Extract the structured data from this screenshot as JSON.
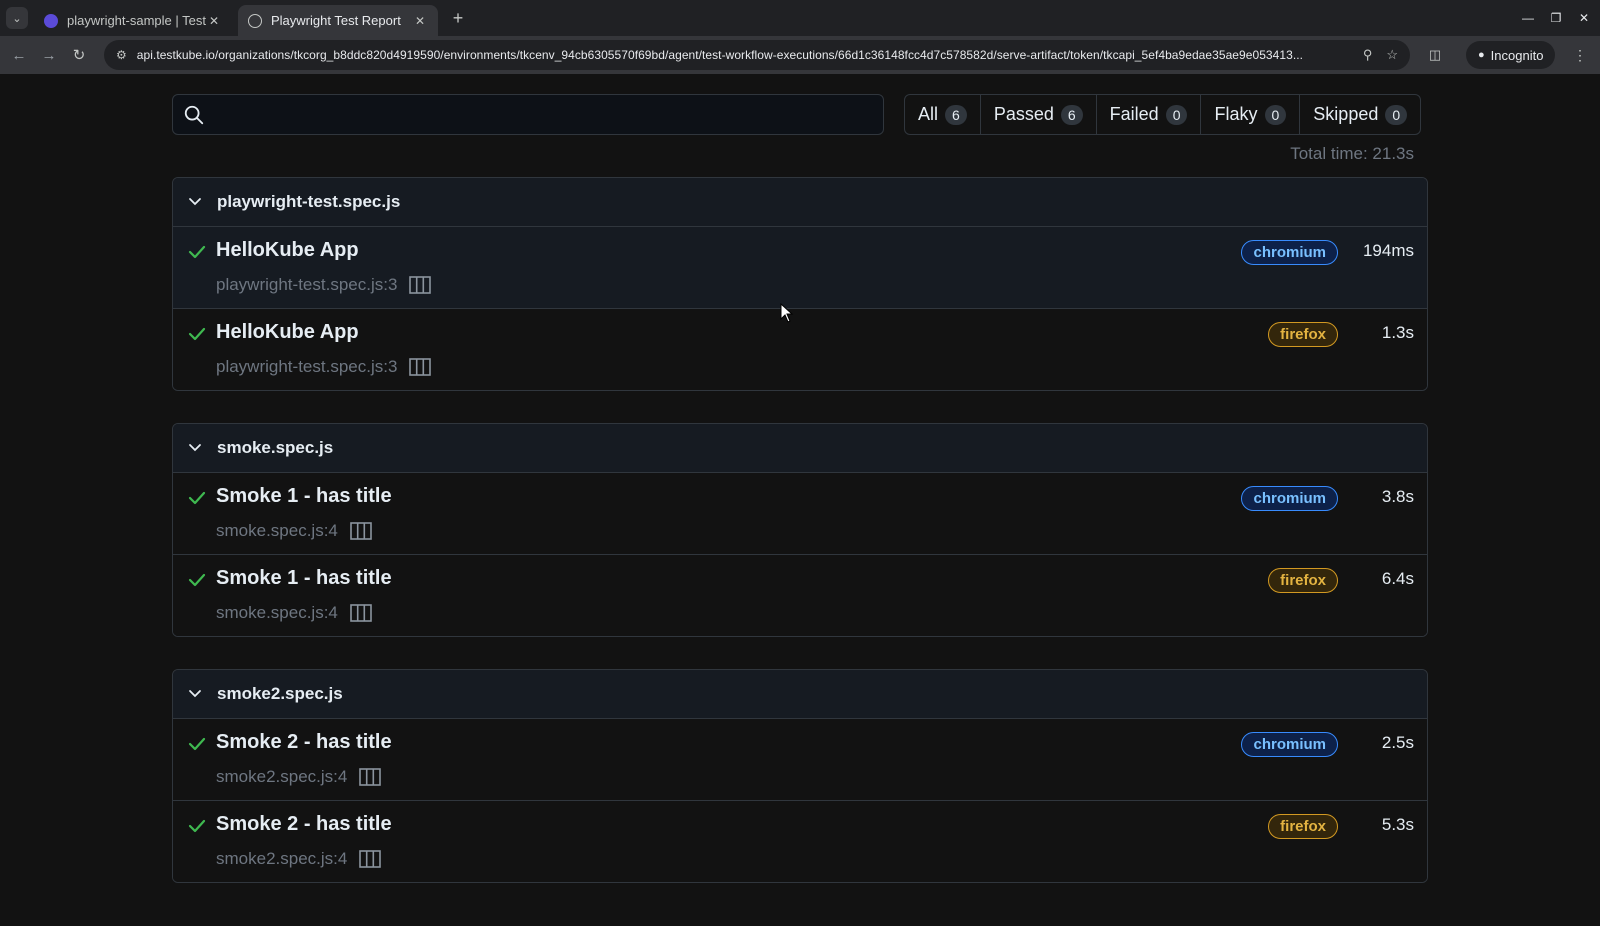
{
  "browser": {
    "tabs": [
      {
        "title": "playwright-sample | Testkube",
        "active": false
      },
      {
        "title": "Playwright Test Report",
        "active": true
      }
    ],
    "url": "api.testkube.io/organizations/tkcorg_b8ddc820d4919590/environments/tkcenv_94cb6305570f69bd/agent/test-workflow-executions/66d1c36148fcc4d7c578582d/serve-artifact/token/tkcapi_5ef4ba9edae35ae9e053413...",
    "incognito_label": "Incognito"
  },
  "search": {
    "value": "",
    "placeholder": ""
  },
  "filters": [
    {
      "label": "All",
      "count": "6"
    },
    {
      "label": "Passed",
      "count": "6"
    },
    {
      "label": "Failed",
      "count": "0"
    },
    {
      "label": "Flaky",
      "count": "0"
    },
    {
      "label": "Skipped",
      "count": "0"
    }
  ],
  "total_time": "Total time: 21.3s",
  "groups": [
    {
      "file": "playwright-test.spec.js",
      "tests": [
        {
          "title": "HelloKube App",
          "location": "playwright-test.spec.js:3",
          "project": "chromium",
          "duration": "194ms",
          "status": "passed"
        },
        {
          "title": "HelloKube App",
          "location": "playwright-test.spec.js:3",
          "project": "firefox",
          "duration": "1.3s",
          "status": "passed"
        }
      ]
    },
    {
      "file": "smoke.spec.js",
      "tests": [
        {
          "title": "Smoke 1 - has title",
          "location": "smoke.spec.js:4",
          "project": "chromium",
          "duration": "3.8s",
          "status": "passed"
        },
        {
          "title": "Smoke 1 - has title",
          "location": "smoke.spec.js:4",
          "project": "firefox",
          "duration": "6.4s",
          "status": "passed"
        }
      ]
    },
    {
      "file": "smoke2.spec.js",
      "tests": [
        {
          "title": "Smoke 2 - has title",
          "location": "smoke2.spec.js:4",
          "project": "chromium",
          "duration": "2.5s",
          "status": "passed"
        },
        {
          "title": "Smoke 2 - has title",
          "location": "smoke2.spec.js:4",
          "project": "firefox",
          "duration": "5.3s",
          "status": "passed"
        }
      ]
    }
  ],
  "colors": {
    "passed": "#3fb950",
    "chromium": "#79c0ff",
    "firefox": "#e3b341",
    "background": "#121212"
  }
}
